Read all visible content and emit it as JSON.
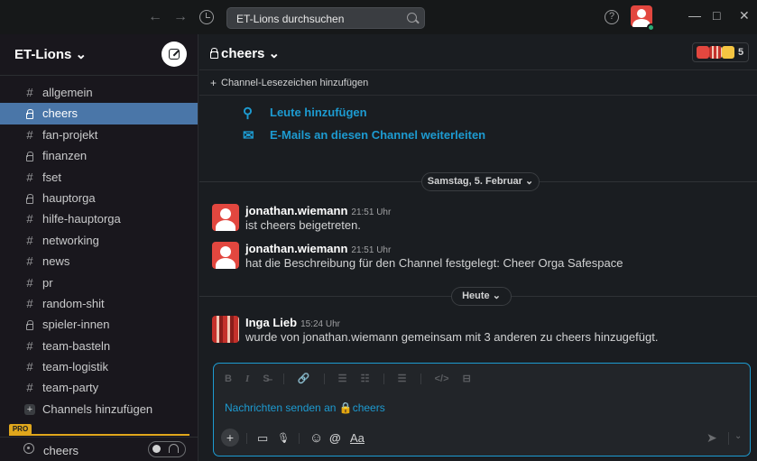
{
  "titlebar": {
    "back": "←",
    "forward": "→",
    "search_placeholder": "ET-Lions durchsuchen",
    "help": "?",
    "minimize": "—",
    "maximize": "□",
    "close": "✕"
  },
  "sidebar": {
    "workspace": "ET-Lions ⌄",
    "channels": [
      {
        "name": "allgemein",
        "type": "hash"
      },
      {
        "name": "cheers",
        "type": "lock",
        "active": true
      },
      {
        "name": "fan-projekt",
        "type": "hash"
      },
      {
        "name": "finanzen",
        "type": "lock"
      },
      {
        "name": "fset",
        "type": "hash"
      },
      {
        "name": "hauptorga",
        "type": "lock"
      },
      {
        "name": "hilfe-hauptorga",
        "type": "hash"
      },
      {
        "name": "networking",
        "type": "hash"
      },
      {
        "name": "news",
        "type": "hash"
      },
      {
        "name": "pr",
        "type": "hash"
      },
      {
        "name": "random-shit",
        "type": "hash"
      },
      {
        "name": "spieler-innen",
        "type": "lock"
      },
      {
        "name": "team-basteln",
        "type": "hash"
      },
      {
        "name": "team-logistik",
        "type": "hash"
      },
      {
        "name": "team-party",
        "type": "hash"
      }
    ],
    "add_channels": "Channels hinzufügen",
    "pro_badge": "PRO",
    "huddle_channel": "cheers"
  },
  "channel": {
    "title": "cheers ⌄",
    "member_count": "5",
    "bookmark_label": "Channel-Lesezeichen hinzufügen",
    "actions": {
      "add_people": "Leute hinzufügen",
      "email_forward": "E-Mails an diesen Channel weiterleiten"
    }
  },
  "messages": {
    "date1": "Samstag, 5. Februar ⌄",
    "date2": "Heute ⌄",
    "items": [
      {
        "author": "jonathan.wiemann",
        "time": "21:51 Uhr",
        "text": "ist cheers beigetreten."
      },
      {
        "author": "jonathan.wiemann",
        "time": "21:51 Uhr",
        "text": "hat die Beschreibung für den Channel festgelegt: Cheer Orga Safespace"
      },
      {
        "author": "Inga Lieb",
        "time": "15:24 Uhr",
        "text": "wurde von jonathan.wiemann gemeinsam mit 3 anderen zu cheers hinzugefügt."
      }
    ]
  },
  "composer": {
    "placeholder": "Nachrichten senden an 🔒cheers",
    "format": [
      "B",
      "I",
      "S̶",
      "🔗",
      "☰",
      "☷",
      "☰",
      "</>",
      "⊟"
    ],
    "tools": {
      "plus": "+",
      "video": "▭",
      "mic": "🎙",
      "emoji": "☺",
      "mention": "@",
      "text": "Aa"
    },
    "send": "➤",
    "send_more": "⌄"
  },
  "colors": {
    "accent": "#1d9bd1",
    "active_channel": "#4a76a8",
    "presence": "#2bac76",
    "pro": "#e0a71c"
  }
}
